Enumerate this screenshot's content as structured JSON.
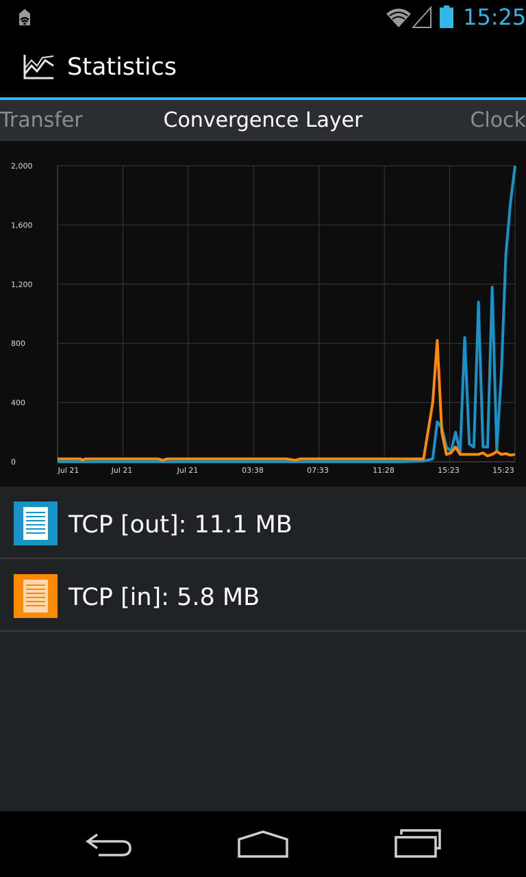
{
  "status_bar": {
    "time": "15:25",
    "icons": [
      "notification-icon",
      "wifi-icon",
      "signal-icon",
      "battery-icon"
    ]
  },
  "action_bar": {
    "title": "Statistics",
    "icon": "line-chart-icon"
  },
  "tabs": {
    "left": "Transfer",
    "center": "Convergence Layer",
    "right": "Clock"
  },
  "chart_data": {
    "type": "line",
    "title": "",
    "xlabel": "",
    "ylabel": "",
    "ylim": [
      0,
      2000
    ],
    "yticks": [
      "2,000",
      "1,600",
      "1,200",
      "800",
      "400",
      "0"
    ],
    "xticks": [
      "Jul 21",
      "Jul 21",
      "Jul 21",
      "03:38",
      "07:33",
      "11:28",
      "15:23",
      "15:23"
    ],
    "grid": true,
    "series": [
      {
        "name": "TCP [out]",
        "color": "#1793c9",
        "x": [
          0,
          5,
          10,
          15,
          20,
          25,
          30,
          35,
          40,
          45,
          50,
          55,
          60,
          65,
          70,
          75,
          80,
          82,
          83,
          84,
          85,
          86,
          87,
          88,
          89,
          90,
          91,
          92,
          93,
          94,
          95,
          96,
          97,
          98,
          99,
          100
        ],
        "values": [
          0,
          0,
          0,
          0,
          0,
          0,
          0,
          0,
          0,
          0,
          0,
          0,
          0,
          0,
          0,
          0,
          5,
          20,
          270,
          230,
          100,
          70,
          200,
          60,
          840,
          120,
          100,
          1080,
          100,
          100,
          1180,
          80,
          600,
          1400,
          1750,
          2000
        ]
      },
      {
        "name": "TCP [in]",
        "color": "#ff8a00",
        "x": [
          0,
          5,
          5.5,
          6,
          10,
          15,
          20,
          22,
          23,
          24,
          30,
          35,
          40,
          50,
          52,
          53,
          54,
          60,
          65,
          70,
          75,
          80,
          82,
          83,
          84,
          85,
          86,
          87,
          88,
          89,
          90,
          91,
          92,
          93,
          94,
          95,
          96,
          97,
          98,
          99,
          100
        ],
        "values": [
          20,
          20,
          10,
          20,
          20,
          20,
          20,
          20,
          10,
          20,
          20,
          20,
          20,
          20,
          10,
          20,
          20,
          20,
          20,
          20,
          20,
          20,
          400,
          820,
          200,
          50,
          60,
          100,
          50,
          50,
          50,
          50,
          50,
          60,
          40,
          50,
          70,
          50,
          55,
          45,
          50
        ]
      }
    ]
  },
  "legend": [
    {
      "label": "TCP [out]: 11.1 MB",
      "color": "#1793c9",
      "icon": "document-icon"
    },
    {
      "label": "TCP [in]: 5.8 MB",
      "color": "#ff8a00",
      "icon": "document-icon"
    }
  ],
  "nav_bar": {
    "buttons": [
      "back-icon",
      "home-icon",
      "recents-icon"
    ]
  }
}
